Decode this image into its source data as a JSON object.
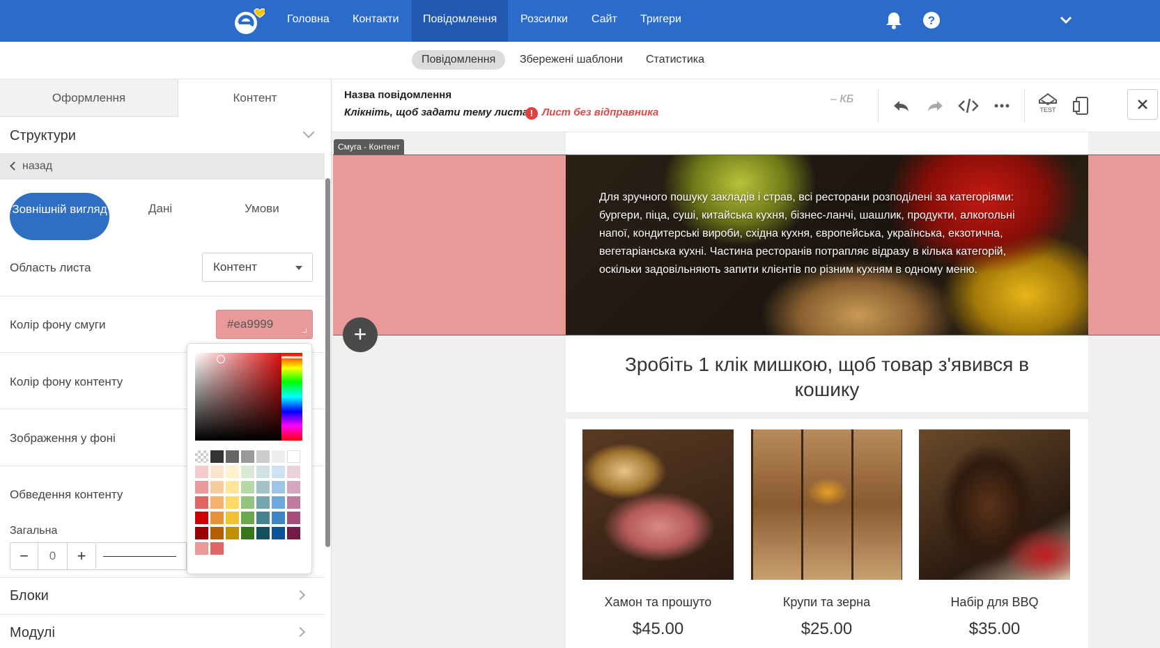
{
  "nav": {
    "items": [
      {
        "label": "Головна"
      },
      {
        "label": "Контакти"
      },
      {
        "label": "Повідомлення"
      },
      {
        "label": "Розсилки"
      },
      {
        "label": "Сайт"
      },
      {
        "label": "Тригери"
      }
    ],
    "active_index": 2,
    "icons": [
      "bell-icon",
      "help-icon",
      "chevron-down-icon"
    ],
    "brand_color": "#2b6bc9"
  },
  "subnav": {
    "tabs": [
      {
        "label": "Повідомлення"
      },
      {
        "label": "Збережені шаблони"
      },
      {
        "label": "Статистика"
      }
    ],
    "active_index": 0
  },
  "left_panel": {
    "tabs": [
      {
        "label": "Оформлення"
      },
      {
        "label": "Контент"
      }
    ],
    "active_tab": 1,
    "structures_title": "Структури",
    "back_label": "назад",
    "subtabs": [
      {
        "label": "Зовнішній вигляд"
      },
      {
        "label": "Дані"
      },
      {
        "label": "Умови"
      }
    ],
    "area_label": "Область листа",
    "area_value": "Контент",
    "band_bg_label": "Колір фону смуги",
    "band_bg_value": "#ea9999",
    "content_bg_label": "Колір фону контенту",
    "bg_image_label": "Зображення у фоні",
    "border_label": "Обведення контенту",
    "general_label": "Загальна",
    "border_width": "0",
    "blocks_title": "Блоки",
    "modules_title": "Модулі"
  },
  "picker": {
    "swatches": [
      [
        "checker",
        "#333333",
        "#666666",
        "#999999",
        "#cccccc",
        "#eeeeee",
        "#ffffff"
      ],
      [
        "#f4cccc",
        "#fce5cd",
        "#fff2cc",
        "#d9ead3",
        "#d0e0e3",
        "#cfe2f3",
        "#ead1dc"
      ],
      [
        "#ea9999",
        "#f9cb9c",
        "#ffe599",
        "#b6d7a8",
        "#a2c4c9",
        "#9fc5e8",
        "#d5a6bd"
      ],
      [
        "#e06666",
        "#f6b26b",
        "#ffd966",
        "#93c47d",
        "#76a5af",
        "#6fa8dc",
        "#c27ba0"
      ],
      [
        "#cc0000",
        "#e69138",
        "#f1c232",
        "#6aa84f",
        "#45818e",
        "#3d85c6",
        "#a64d79"
      ],
      [
        "#990000",
        "#b45f06",
        "#bf9000",
        "#38761d",
        "#134f5c",
        "#0b5394",
        "#741b47"
      ],
      [
        "#ea9999",
        "#e06666"
      ]
    ]
  },
  "editor": {
    "message_name": "Назва повідомлення",
    "subject_prompt": "Клікніть, щоб задати тему листа",
    "warning": "Лист без відправника",
    "size": "– КБ",
    "toolbar_icons": [
      "undo-icon",
      "redo-icon",
      "code-icon",
      "more-icon",
      "test-icon",
      "preview-icon"
    ],
    "test_label": "TEST"
  },
  "canvas": {
    "band_label": "Смуга - Контент",
    "band_color": "#ea9999",
    "hero_text": "Для зручного пошуку закладів і страв, всі ресторани розподілені за категоріями: бургери, піца, суші, китайська кухня, бізнес-ланчі, шашлик, продукти, алкогольні напої, кондитерські вироби, східна кухня, європейська, українська, екзотична, вегетаріанська кухні. Частина ресторанів потрапляє відразу в кілька категорій, оскільки задовільняють запити клієнтів по різним кухням в одному меню.",
    "headline": "Зробіть 1 клік мишкою, щоб товар з'явився в кошику",
    "products": [
      {
        "name": "Хамон та прошуто",
        "price": "$45.00"
      },
      {
        "name": "Крупи та зерна",
        "price": "$25.00"
      },
      {
        "name": "Набір для BBQ",
        "price": "$35.00"
      }
    ]
  }
}
